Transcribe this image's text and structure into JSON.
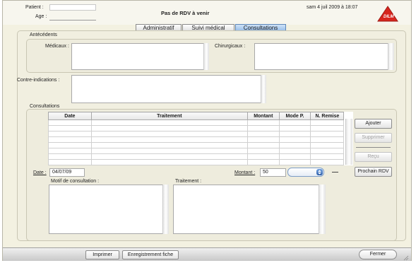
{
  "header": {
    "patient_label": "Patient :",
    "age_label": "Age :",
    "status_title": "Pas de RDV à venir",
    "datetime": "sam 4 juil 2009 à 18:07",
    "logo_text": "DILM"
  },
  "tabs": [
    {
      "label": "Administratif",
      "active": false
    },
    {
      "label": "Suivi médical",
      "active": false
    },
    {
      "label": "Consultations",
      "active": true
    }
  ],
  "antecedents": {
    "section_label": "Antécédents",
    "medicaux_label": "Médicaux :",
    "chirurgicaux_label": "Chirurgicaux :"
  },
  "contre_indications_label": "Contre-indications :",
  "consultations": {
    "section_label": "Consultations",
    "columns": [
      "Date",
      "Traitement",
      "Montant",
      "Mode P.",
      "N. Remise"
    ],
    "row_count_visible": 8,
    "buttons": {
      "ajouter": "Ajouter",
      "supprimer": "Supprimer",
      "recu": "Reçu",
      "prochain_rdv": "Prochain RDV"
    },
    "date_label": "Date :",
    "date_value": "04/07/09",
    "montant_label": "Montant :",
    "montant_value": "50",
    "mode_select_value": "",
    "motif_label": "Motif de consultation :",
    "traitement_label": "Traitement :"
  },
  "footer": {
    "imprimer": "Imprimer",
    "enregistrement": "Enregistrement fiche",
    "fermer": "Fermer"
  },
  "colors": {
    "window_bg": "#f3f1e1",
    "tab_active": "#8fb7e6",
    "logo_red": "#d7261e"
  }
}
